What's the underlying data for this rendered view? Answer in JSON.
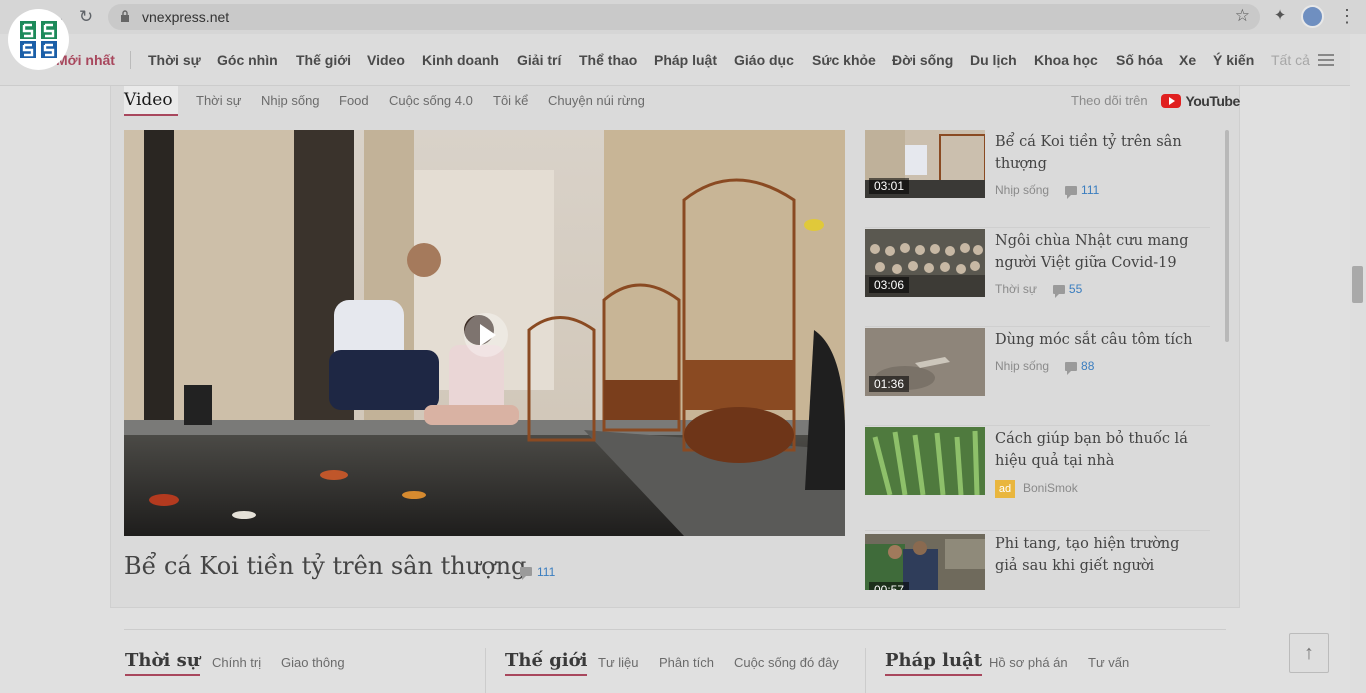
{
  "browser": {
    "url": "vnexpress.net"
  },
  "nav": {
    "latest": "Mới nhất",
    "items": [
      "Thời sự",
      "Góc nhìn",
      "Thế giới",
      "Video",
      "Kinh doanh",
      "Giải trí",
      "Thể thao",
      "Pháp luật",
      "Giáo dục",
      "Sức khỏe",
      "Đời sống",
      "Du lịch",
      "Khoa học",
      "Số hóa",
      "Xe",
      "Ý kiến"
    ],
    "all": "Tất cả"
  },
  "video_section": {
    "title": "Video",
    "tabs": [
      "Thời sự",
      "Nhịp sống",
      "Food",
      "Cuộc sống 4.0",
      "Tôi kể",
      "Chuyện núi rừng"
    ],
    "follow": "Theo dõi trên",
    "youtube": "YouTube",
    "main": {
      "title": "Bể cá Koi tiền tỷ trên sân thượng",
      "comments": "111"
    },
    "list": [
      {
        "title": "Bể cá Koi tiền tỷ trên sân thượng",
        "duration": "03:01",
        "category": "Nhịp sống",
        "comments": "111"
      },
      {
        "title": "Ngôi chùa Nhật cưu mang người Việt giữa Covid-19",
        "duration": "03:06",
        "category": "Thời sự",
        "comments": "55"
      },
      {
        "title": "Dùng móc sắt câu tôm tích",
        "duration": "01:36",
        "category": "Nhịp sống",
        "comments": "88"
      },
      {
        "title": "Cách giúp bạn bỏ thuốc lá hiệu quả tại nhà",
        "ad_label": "ad",
        "sponsor": "BoniSmok"
      },
      {
        "title": "Phi tang, tạo hiện trường giả sau khi giết người",
        "duration": "00:57"
      }
    ]
  },
  "bottom": {
    "sections": [
      {
        "title": "Thời sự",
        "subs": [
          "Chính trị",
          "Giao thông"
        ]
      },
      {
        "title": "Thế giới",
        "subs": [
          "Tư liệu",
          "Phân tích",
          "Cuộc sống đó đây"
        ]
      },
      {
        "title": "Pháp luật",
        "subs": [
          "Hồ sơ phá án",
          "Tư vấn"
        ]
      }
    ]
  },
  "colors": {
    "accent": "#a8475d",
    "link": "#3a7dbf"
  }
}
